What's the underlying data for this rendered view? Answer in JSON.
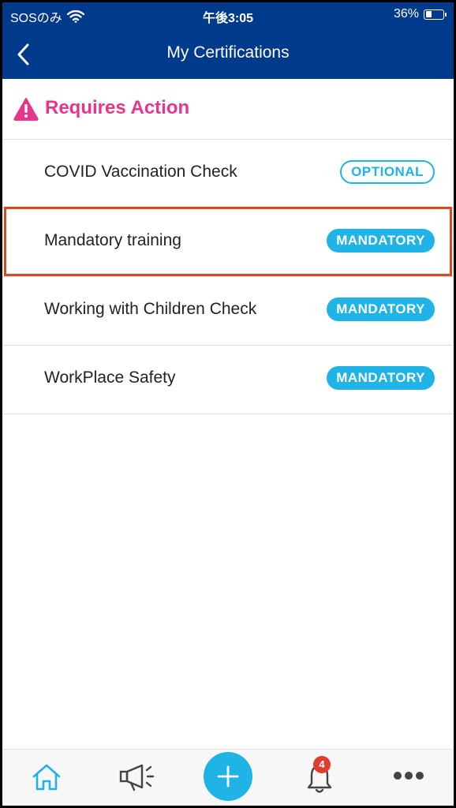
{
  "status_bar": {
    "carrier": "SOSのみ",
    "time": "午後3:05",
    "battery_percent": "36%",
    "battery_level": 0.36
  },
  "nav": {
    "title": "My Certifications",
    "back_icon": "chevron-left-icon"
  },
  "section": {
    "title": "Requires Action",
    "icon": "warning-icon",
    "color": "#e8358a"
  },
  "certifications": [
    {
      "label": "COVID Vaccination Check",
      "badge": "OPTIONAL"
    },
    {
      "label": "Mandatory training",
      "badge": "MANDATORY"
    },
    {
      "label": "Working with Children Check",
      "badge": "MANDATORY"
    },
    {
      "label": "WorkPlace Safety",
      "badge": "MANDATORY"
    }
  ],
  "tabbar": {
    "items": [
      {
        "icon": "home-icon"
      },
      {
        "icon": "megaphone-icon"
      },
      {
        "icon": "plus-icon"
      },
      {
        "icon": "bell-icon",
        "badge_count": "4"
      },
      {
        "icon": "more-icon"
      }
    ]
  },
  "colors": {
    "header_bg": "#003a8c",
    "accent": "#1fb3e6",
    "highlight_border": "#d9481e",
    "notification": "#e33b2e"
  }
}
